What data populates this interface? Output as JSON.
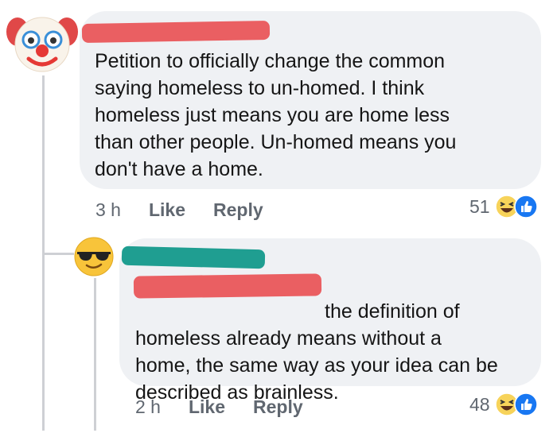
{
  "comment1": {
    "author_name": "",
    "avatar_icon": "clown-face-icon",
    "text": "Petition to officially change the common\nsaying homeless to un-homed. I think\nhomeless just means you are home less\nthan other people. Un-homed means you\ndon't have a home.",
    "time": "3 h",
    "like_label": "Like",
    "reply_label": "Reply",
    "reaction_count": "51",
    "reaction_icons": [
      "laughing-emoji-icon",
      "like-thumb-icon"
    ]
  },
  "comment2": {
    "author_name": "",
    "avatar_icon": "sunglasses-emoji-icon",
    "mention": "",
    "text": "the definition of\nhomeless already means without a\nhome, the same way as your idea can be\ndescribed as brainless.",
    "time": "2 h",
    "like_label": "Like",
    "reply_label": "Reply",
    "reaction_count": "48",
    "reaction_icons": [
      "laughing-emoji-icon",
      "like-thumb-icon"
    ]
  },
  "colors": {
    "bubble": "#eff1f4",
    "redaction_red": "#ea5f62",
    "redaction_teal": "#1f9e91",
    "like_blue": "#1877f2",
    "laugh_yellow": "#f7d35a"
  }
}
